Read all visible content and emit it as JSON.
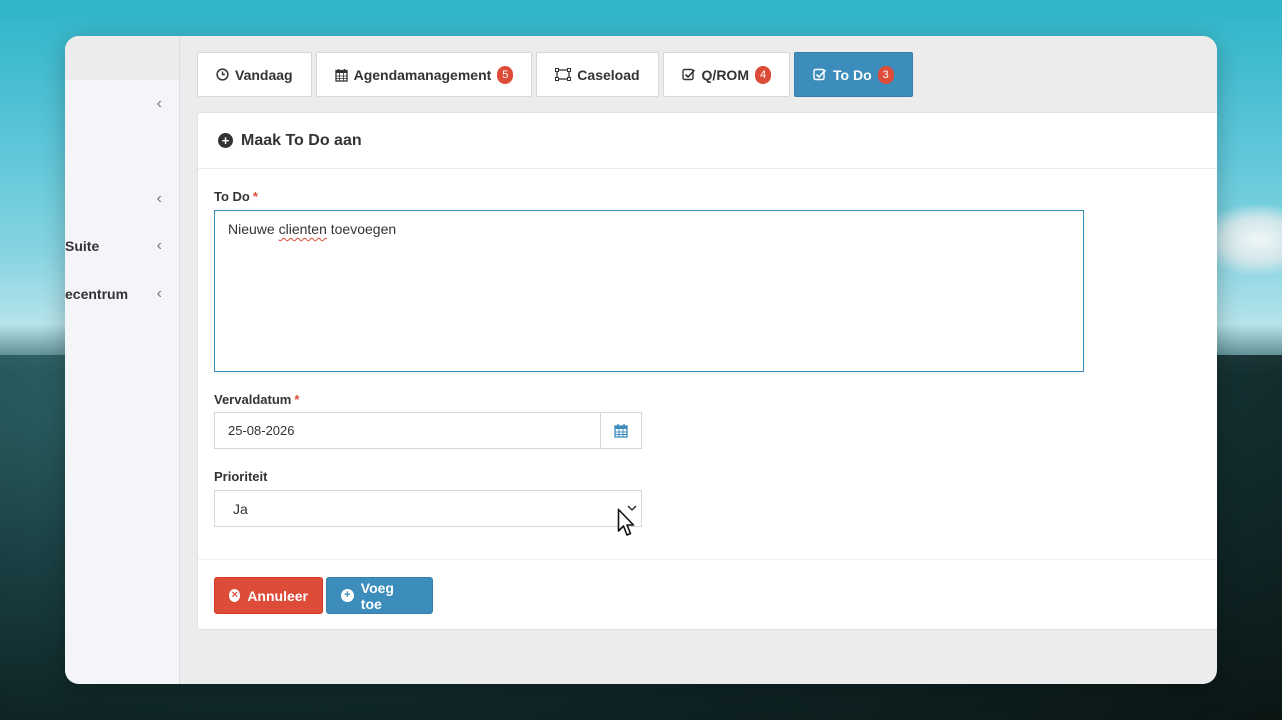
{
  "sidebar": {
    "items": [
      {
        "label": "",
        "chevron": "‹"
      },
      {
        "label": "",
        "chevron": "‹"
      },
      {
        "label": "Suite",
        "chevron": "‹"
      },
      {
        "label": "ecentrum",
        "chevron": "‹"
      }
    ]
  },
  "tabs": [
    {
      "label": "Vandaag",
      "icon": "clock-icon",
      "badge": null
    },
    {
      "label": "Agendamanagement",
      "icon": "calendar-icon",
      "badge": "5"
    },
    {
      "label": "Caseload",
      "icon": "caseload-icon",
      "badge": null
    },
    {
      "label": "Q/ROM",
      "icon": "check-square-icon",
      "badge": "4"
    },
    {
      "label": "To Do",
      "icon": "check-square-icon",
      "badge": "3",
      "active": true
    }
  ],
  "panel": {
    "title": "Maak To Do aan",
    "todo_label": "To Do",
    "todo_value_before": "Nieuwe ",
    "todo_value_misspelled": "clienten",
    "todo_value_after": " toevoegen",
    "due_label": "Vervaldatum",
    "due_value": "25-08-2026",
    "priority_label": "Prioriteit",
    "priority_value": "Ja",
    "required_mark": "*",
    "cancel_label": "Annuleer",
    "add_label": "Voeg toe"
  },
  "colors": {
    "primary": "#3c8dbc",
    "danger": "#dd4b39"
  }
}
